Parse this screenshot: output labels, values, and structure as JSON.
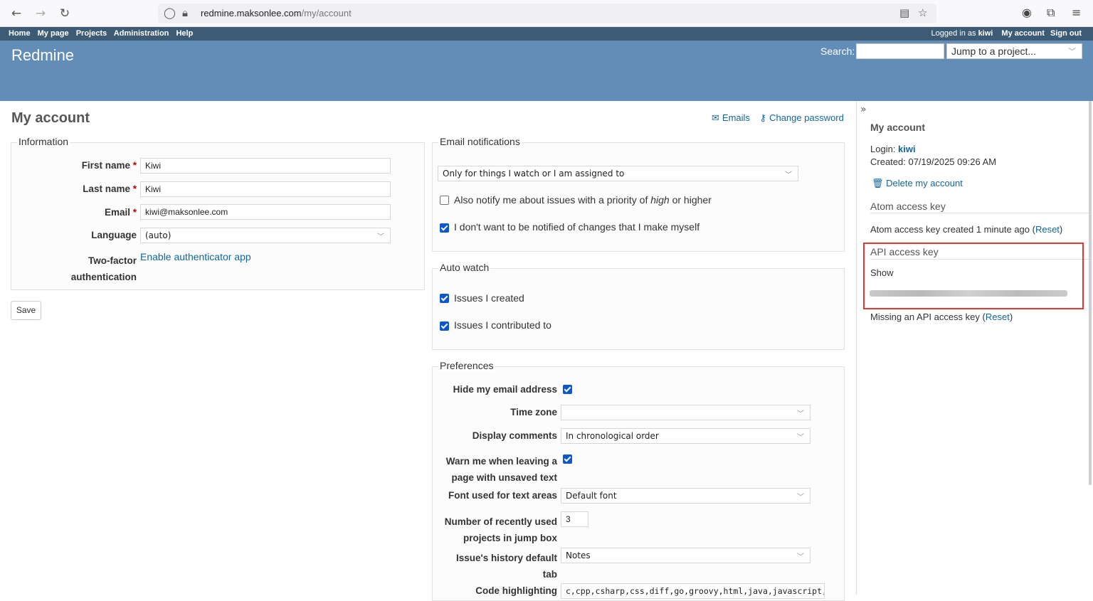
{
  "browser": {
    "url_host": "redmine.maksonlee.com",
    "url_path": "/my/account"
  },
  "top_menu": {
    "items": [
      "Home",
      "My page",
      "Projects",
      "Administration",
      "Help"
    ],
    "logged_in_prefix": "Logged in as",
    "user": "kiwi",
    "my_account": "My account",
    "sign_out": "Sign out"
  },
  "header": {
    "title": "Redmine",
    "search_label": "Search:",
    "jump_placeholder": "Jump to a project..."
  },
  "page": {
    "title": "My account",
    "emails_link": "Emails",
    "change_password_link": "Change password"
  },
  "information": {
    "legend": "Information",
    "first_name_label": "First name",
    "first_name": "Kiwi",
    "last_name_label": "Last name",
    "last_name": "Kiwi",
    "email_label": "Email",
    "email": "kiwi@maksonlee.com",
    "language_label": "Language",
    "language": "(auto)",
    "two_factor_label_1": "Two-factor",
    "two_factor_label_2": "authentication",
    "two_factor_link": "Enable authenticator app",
    "required_mark": "*"
  },
  "save_label": "Save",
  "email_notifications": {
    "legend": "Email notifications",
    "option": "Only for things I watch or I am assigned to",
    "notify_priority_pre": "Also notify me about issues with a priority of ",
    "notify_priority_em": "high",
    "notify_priority_post": " or higher",
    "notify_priority_checked": false,
    "no_self_notified": "I don't want to be notified of changes that I make myself",
    "no_self_notified_checked": true
  },
  "auto_watch": {
    "legend": "Auto watch",
    "issues_created": "Issues I created",
    "issues_created_checked": true,
    "issues_contributed": "Issues I contributed to",
    "issues_contributed_checked": true
  },
  "preferences": {
    "legend": "Preferences",
    "hide_email_label": "Hide my email address",
    "hide_email_checked": true,
    "time_zone_label": "Time zone",
    "time_zone": "",
    "display_comments_label": "Display comments",
    "display_comments": "In chronological order",
    "warn_leaving_label_1": "Warn me when leaving a",
    "warn_leaving_label_2": "page with unsaved text",
    "warn_leaving_checked": true,
    "font_label": "Font used for text areas",
    "font": "Default font",
    "recent_projects_label_1": "Number of recently used",
    "recent_projects_label_2": "projects in jump box",
    "recent_projects": "3",
    "history_tab_label_1": "Issue's history default",
    "history_tab_label_2": "tab",
    "history_tab": "Notes",
    "code_highlighting_label": "Code highlighting",
    "code_highlighting": "c,cpp,csharp,css,diff,go,groovy,html,java,javascript,"
  },
  "sidebar": {
    "title": "My account",
    "login_label": "Login:",
    "login": "kiwi",
    "created": "Created: 07/19/2025 09:26 AM",
    "delete_account": "Delete my account",
    "atom_heading": "Atom access key",
    "atom_text": "Atom access key created 1 minute ago (",
    "atom_reset": "Reset",
    "atom_close": ")",
    "api_heading": "API access key",
    "api_show": "Show",
    "api_missing": "Missing an API access key (",
    "api_reset": "Reset",
    "api_close": ")"
  }
}
